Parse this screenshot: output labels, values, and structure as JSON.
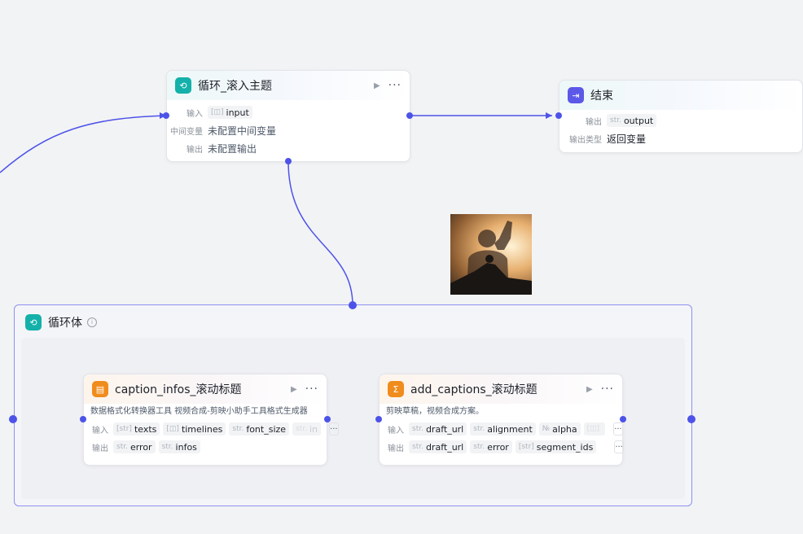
{
  "loop_node": {
    "title": "循环_滚入主题",
    "input_label": "输入",
    "input_tag_type": "[◫]",
    "input_tag": "input",
    "middle_label": "中间变量",
    "middle_value": "未配置中间变量",
    "output_label": "输出",
    "output_value": "未配置输出",
    "icon": "loop-icon"
  },
  "end_node": {
    "title": "结束",
    "output_label": "输出",
    "output_tag_type": "str.",
    "output_tag": "output",
    "output_type_label": "输出类型",
    "output_type_value": "返回变量",
    "icon": "end-icon"
  },
  "loop_body": {
    "title": "循环体",
    "icon": "loop-icon"
  },
  "caption_node": {
    "title": "caption_infos_滚动标题",
    "desc": "数据格式化转换器工具 视频合成-剪映小助手工具格式生成器",
    "input_label": "输入",
    "inputs": [
      {
        "type": "[str]",
        "name": "texts"
      },
      {
        "type": "[◫]",
        "name": "timelines"
      },
      {
        "type": "str.",
        "name": "font_size"
      },
      {
        "type": "str.",
        "name": "in"
      }
    ],
    "output_label": "输出",
    "outputs": [
      {
        "type": "str.",
        "name": "error"
      },
      {
        "type": "str.",
        "name": "infos"
      }
    ],
    "more": "···"
  },
  "add_captions_node": {
    "title": "add_captions_滚动标题",
    "desc": "剪映草稿，视频合成方案。",
    "input_label": "输入",
    "inputs": [
      {
        "type": "str.",
        "name": "draft_url"
      },
      {
        "type": "str.",
        "name": "alignment"
      },
      {
        "type": "№",
        "name": "alpha"
      },
      {
        "type": "[◫]",
        "name": ""
      }
    ],
    "output_label": "输出",
    "outputs": [
      {
        "type": "str.",
        "name": "draft_url"
      },
      {
        "type": "str.",
        "name": "error"
      },
      {
        "type": "[str]",
        "name": "segment_ids"
      }
    ],
    "more": "···"
  },
  "controls": {
    "run": "▶",
    "more": "···"
  },
  "colors": {
    "edge": "#4d53e8",
    "teal": "#13b1a9",
    "purple": "#5c58e8",
    "orange": "#f08c1d"
  }
}
